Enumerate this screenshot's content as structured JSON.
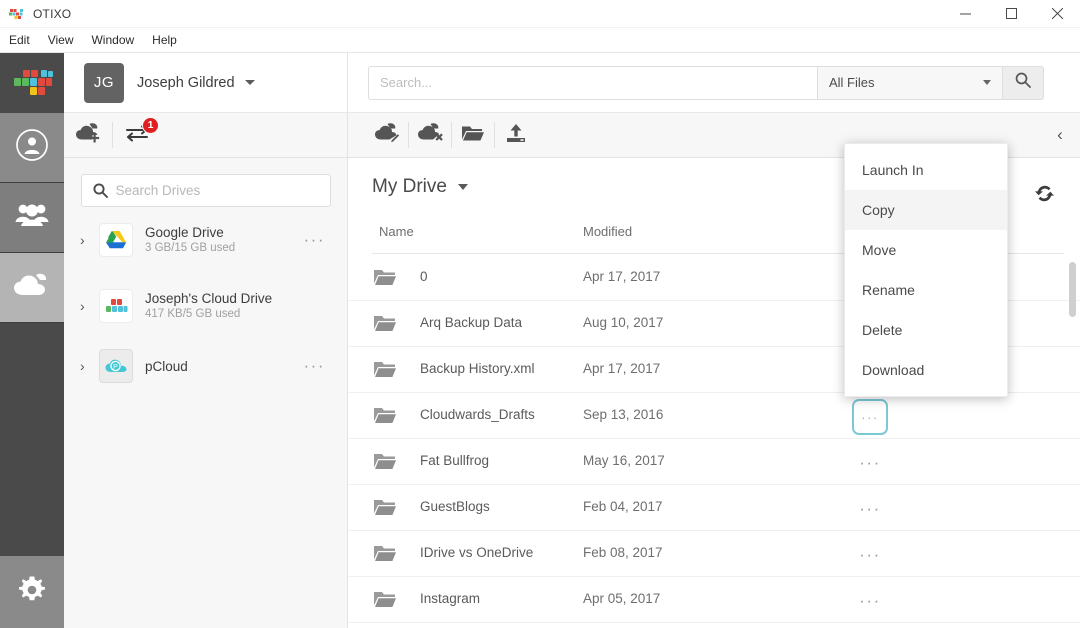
{
  "window": {
    "app_title": "OTIXO",
    "logo_icon": "otixo-logo-icon",
    "minimize_label": "—",
    "maximize_label": "□",
    "close_label": "✕"
  },
  "menubar": {
    "items": [
      {
        "label": "Edit"
      },
      {
        "label": "View"
      },
      {
        "label": "Window"
      },
      {
        "label": "Help"
      }
    ]
  },
  "rail": {
    "logo_icon": "otixo-blocks-logo-icon",
    "items": [
      {
        "icon": "person-circle-icon",
        "name": "account"
      },
      {
        "icon": "people-group-icon",
        "name": "contacts"
      },
      {
        "icon": "cloud-icon",
        "name": "drives",
        "selected": true
      }
    ],
    "settings": {
      "icon": "gear-icon",
      "name": "settings"
    }
  },
  "account": {
    "initials": "JG",
    "name": "Joseph Gildred",
    "dropdown_icon": "chevron-down-icon"
  },
  "left_toolbar": {
    "add_cloud_icon": "cloud-add-icon",
    "transfers_icon": "transfers-arrows-icon",
    "transfers_badge": "1"
  },
  "drives_panel": {
    "search": {
      "placeholder": "Search Drives",
      "value": "",
      "icon": "search-icon"
    },
    "items": [
      {
        "name": "Google Drive",
        "usage": "3 GB/15 GB used",
        "icon": "google-drive-icon",
        "expand_icon": "chevron-right-icon",
        "more_label": "···",
        "selected": false
      },
      {
        "name": "Joseph's Cloud Drive",
        "usage": "417 KB/5 GB used",
        "icon": "otixo-drive-icon",
        "expand_icon": "chevron-right-icon",
        "more_label": "",
        "selected": false
      },
      {
        "name": "pCloud",
        "usage": "",
        "icon": "pcloud-icon",
        "expand_icon": "chevron-right-icon",
        "more_label": "···",
        "selected": true
      }
    ]
  },
  "search_header": {
    "placeholder": "Search...",
    "value": "",
    "filter_label": "All Files",
    "filter_caret_icon": "caret-down-icon",
    "search_button_icon": "search-icon"
  },
  "main_toolbar": {
    "buttons": [
      {
        "icon": "cloud-edit-icon",
        "name": "edit-drive"
      },
      {
        "icon": "cloud-remove-icon",
        "name": "remove-drive"
      },
      {
        "icon": "new-folder-icon",
        "name": "new-folder"
      },
      {
        "icon": "upload-icon",
        "name": "upload"
      }
    ],
    "collapse_icon": "chevron-left-icon"
  },
  "file_area": {
    "breadcrumb": "My Drive",
    "breadcrumb_caret_icon": "caret-down-icon",
    "refresh_icon": "refresh-icon",
    "columns": {
      "name": "Name",
      "modified": "Modified"
    },
    "row_more_label": "···",
    "rows": [
      {
        "name": "0",
        "modified": "Apr 17, 2017",
        "icon": "folder-icon",
        "active": false
      },
      {
        "name": "Arq Backup Data",
        "modified": "Aug 10, 2017",
        "icon": "folder-icon",
        "active": false
      },
      {
        "name": "Backup History.xml",
        "modified": "Apr 17, 2017",
        "icon": "folder-icon",
        "active": false
      },
      {
        "name": "Cloudwards_Drafts",
        "modified": "Sep 13, 2016",
        "icon": "folder-icon",
        "active": true
      },
      {
        "name": "Fat Bullfrog",
        "modified": "May 16, 2017",
        "icon": "folder-icon",
        "active": false
      },
      {
        "name": "GuestBlogs",
        "modified": "Feb 04, 2017",
        "icon": "folder-icon",
        "active": false
      },
      {
        "name": "IDrive vs OneDrive",
        "modified": "Feb 08, 2017",
        "icon": "folder-icon",
        "active": false
      },
      {
        "name": "Instagram",
        "modified": "Apr 05, 2017",
        "icon": "folder-icon",
        "active": false
      }
    ]
  },
  "context_menu": {
    "items": [
      {
        "label": "Launch In",
        "highlighted": false
      },
      {
        "label": "Copy",
        "highlighted": true
      },
      {
        "label": "Move",
        "highlighted": false
      },
      {
        "label": "Rename",
        "highlighted": false
      },
      {
        "label": "Delete",
        "highlighted": false
      },
      {
        "label": "Download",
        "highlighted": false
      }
    ]
  },
  "colors": {
    "rail_bg": "#4a4a4a",
    "accent_teal": "#7cc9d6",
    "badge_red": "#e02020",
    "panel_bg": "#f7f7f7"
  }
}
